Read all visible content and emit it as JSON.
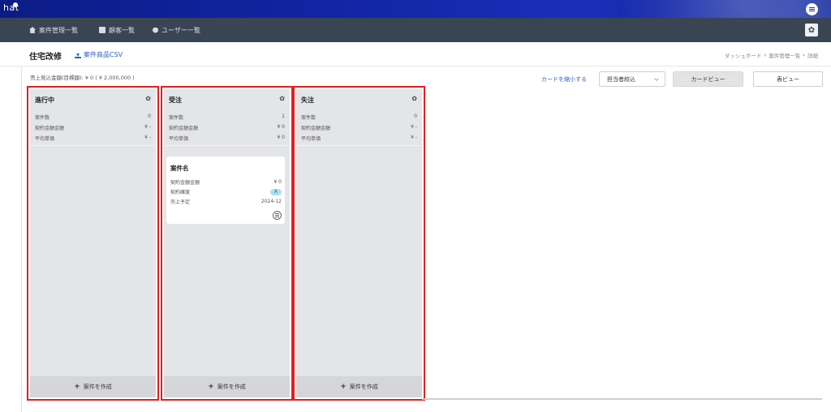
{
  "brand": {
    "logo_text": "hat"
  },
  "nav": {
    "items": [
      {
        "label": "案件管理一覧",
        "icon": "home-icon"
      },
      {
        "label": "顧客一覧",
        "icon": "book-icon"
      },
      {
        "label": "ユーザー一覧",
        "icon": "user-icon"
      }
    ]
  },
  "page": {
    "title": "住宅改修",
    "csv_link": "案件商品CSV",
    "breadcrumb": [
      "ダッシュボード",
      "案件管理一覧",
      "詳細"
    ]
  },
  "summary": "売上見込金額(目標額): ¥ 0 ( ¥ 2,000,000 )",
  "controls": {
    "shrink_cards": "カードを縮小する",
    "assignee_filter": "担当者絞込",
    "card_view": "カードビュー",
    "table_view": "表ビュー"
  },
  "columns": [
    {
      "title": "進行中",
      "stats": [
        {
          "label": "案件数",
          "value": "0"
        },
        {
          "label": "契約金額金額",
          "value": "¥ -"
        },
        {
          "label": "平均単価",
          "value": "¥ -"
        }
      ],
      "create_label": "案件を作成"
    },
    {
      "title": "受注",
      "stats": [
        {
          "label": "案件数",
          "value": "1"
        },
        {
          "label": "契約金額金額",
          "value": "¥ 0"
        },
        {
          "label": "平均単価",
          "value": "¥ 0"
        }
      ],
      "card": {
        "title": "案件名",
        "rows": [
          {
            "label": "契約金額金額",
            "value": "¥ 0"
          },
          {
            "label": "契約確度",
            "value": "A"
          },
          {
            "label": "売上予定",
            "value": "2024-12"
          }
        ]
      },
      "create_label": "案件を作成"
    },
    {
      "title": "失注",
      "stats": [
        {
          "label": "案件数",
          "value": "0"
        },
        {
          "label": "契約金額金額",
          "value": "¥ -"
        },
        {
          "label": "平均単価",
          "value": "¥ -"
        }
      ],
      "create_label": "案件を作成"
    }
  ],
  "colors": {
    "accent": "#2f64c8",
    "highlight": "#e02020",
    "nav_bg": "#3a4554",
    "brand_bg": "#1226a8"
  }
}
